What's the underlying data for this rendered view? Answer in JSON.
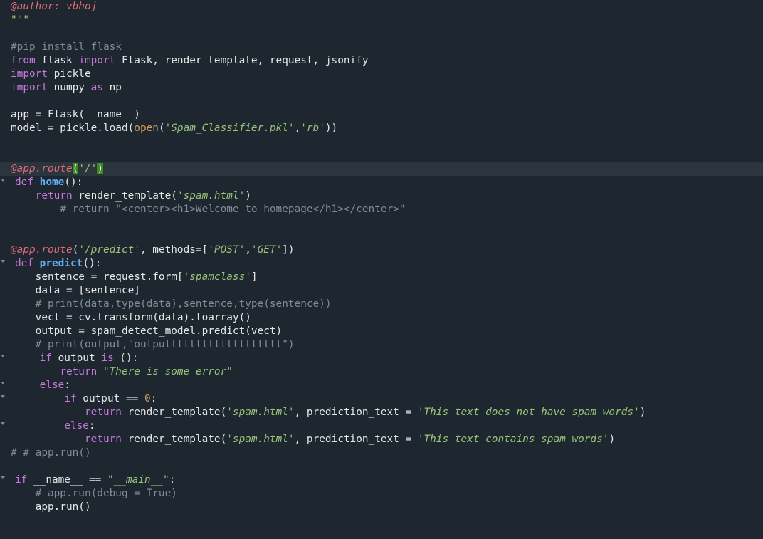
{
  "editor": {
    "lines": [
      [
        {
          "t": "@author: vbhoj",
          "c": "dec"
        }
      ],
      [
        {
          "t": "\"\"\"",
          "c": "strp"
        }
      ],
      [],
      [
        {
          "t": "#pip install flask",
          "c": "cm"
        }
      ],
      [
        {
          "t": "from",
          "c": "kw"
        },
        {
          "t": " flask "
        },
        {
          "t": "import",
          "c": "kw"
        },
        {
          "t": " Flask, render_template, request, jsonify"
        }
      ],
      [
        {
          "t": "import",
          "c": "kw"
        },
        {
          "t": " pickle"
        }
      ],
      [
        {
          "t": "import",
          "c": "kw"
        },
        {
          "t": " numpy "
        },
        {
          "t": "as",
          "c": "kw"
        },
        {
          "t": " np"
        }
      ],
      [],
      [
        {
          "t": "app = Flask(__name__)"
        }
      ],
      [
        {
          "t": "model = pickle.load("
        },
        {
          "t": "open",
          "c": "bi"
        },
        {
          "t": "("
        },
        {
          "t": "'Spam_Classifier.pkl'",
          "c": "str"
        },
        {
          "t": ","
        },
        {
          "t": "'rb'",
          "c": "str"
        },
        {
          "t": "))"
        }
      ],
      [],
      [],
      [
        {
          "t": "@app.route",
          "c": "dec"
        },
        {
          "t": "(",
          "c": "br-hl"
        },
        {
          "t": "'/'",
          "c": "str"
        },
        {
          "t": ")",
          "c": "br-hl"
        }
      ],
      [
        {
          "t": "def",
          "c": "kw"
        },
        {
          "t": " "
        },
        {
          "t": "home",
          "c": "fn"
        },
        {
          "t": "():"
        }
      ],
      [
        {
          "t": "    "
        },
        {
          "t": "return",
          "c": "kw"
        },
        {
          "t": " render_template("
        },
        {
          "t": "'spam.html'",
          "c": "str"
        },
        {
          "t": ")"
        }
      ],
      [
        {
          "t": "        "
        },
        {
          "t": "# return \"<center><h1>Welcome to homepage</h1></center>\"",
          "c": "cm"
        }
      ],
      [],
      [],
      [
        {
          "t": "@app.route",
          "c": "dec"
        },
        {
          "t": "("
        },
        {
          "t": "'/predict'",
          "c": "str"
        },
        {
          "t": ", methods=["
        },
        {
          "t": "'POST'",
          "c": "str"
        },
        {
          "t": ","
        },
        {
          "t": "'GET'",
          "c": "str"
        },
        {
          "t": "])"
        }
      ],
      [
        {
          "t": "def",
          "c": "kw"
        },
        {
          "t": " "
        },
        {
          "t": "predict",
          "c": "fn"
        },
        {
          "t": "():"
        }
      ],
      [
        {
          "t": "    sentence = request.form["
        },
        {
          "t": "'spamclass'",
          "c": "str"
        },
        {
          "t": "]"
        }
      ],
      [
        {
          "t": "    data = [sentence]"
        }
      ],
      [
        {
          "t": "    "
        },
        {
          "t": "# print(data,type(data),sentence,type(sentence))",
          "c": "cm"
        }
      ],
      [
        {
          "t": "    vect = cv.transform(data).toarray()"
        }
      ],
      [
        {
          "t": "    output = spam_detect_model.predict(vect)"
        }
      ],
      [
        {
          "t": "    "
        },
        {
          "t": "# print(output,\"outputtttttttttttttttttt\")",
          "c": "cm"
        }
      ],
      [
        {
          "t": "    "
        },
        {
          "t": "if",
          "c": "kw"
        },
        {
          "t": " output "
        },
        {
          "t": "is",
          "c": "kw"
        },
        {
          "t": " ():"
        }
      ],
      [
        {
          "t": "        "
        },
        {
          "t": "return",
          "c": "kw"
        },
        {
          "t": " "
        },
        {
          "t": "\"There is some error\"",
          "c": "str"
        }
      ],
      [
        {
          "t": "    "
        },
        {
          "t": "else",
          "c": "kw"
        },
        {
          "t": ":"
        }
      ],
      [
        {
          "t": "        "
        },
        {
          "t": "if",
          "c": "kw"
        },
        {
          "t": " output == "
        },
        {
          "t": "0",
          "c": "num"
        },
        {
          "t": ":"
        }
      ],
      [
        {
          "t": "            "
        },
        {
          "t": "return",
          "c": "kw"
        },
        {
          "t": " render_template("
        },
        {
          "t": "'spam.html'",
          "c": "str"
        },
        {
          "t": ", prediction_text = "
        },
        {
          "t": "'This text does not have spam words'",
          "c": "str"
        },
        {
          "t": ")"
        }
      ],
      [
        {
          "t": "        "
        },
        {
          "t": "else",
          "c": "kw"
        },
        {
          "t": ":"
        }
      ],
      [
        {
          "t": "            "
        },
        {
          "t": "return",
          "c": "kw"
        },
        {
          "t": " render_template("
        },
        {
          "t": "'spam.html'",
          "c": "str"
        },
        {
          "t": ", prediction_text = "
        },
        {
          "t": "'This text contains spam words'",
          "c": "str"
        },
        {
          "t": ")"
        }
      ],
      [
        {
          "t": "# # app.run()",
          "c": "cm"
        }
      ],
      [],
      [
        {
          "t": "if",
          "c": "kw"
        },
        {
          "t": " __name__ == "
        },
        {
          "t": "\"__main__\"",
          "c": "str"
        },
        {
          "t": ":"
        }
      ],
      [
        {
          "t": "    "
        },
        {
          "t": "# app.run(debug = True)",
          "c": "cm"
        }
      ],
      [
        {
          "t": "    app.run()"
        }
      ]
    ]
  },
  "colors": {
    "background": "#1e2730",
    "keyword": "#c678dd",
    "function": "#61afef",
    "decorator": "#e06c75",
    "string": "#98c379",
    "comment": "#7f8b96",
    "number": "#d19a66",
    "bracket_match": "#3a8a1f"
  }
}
